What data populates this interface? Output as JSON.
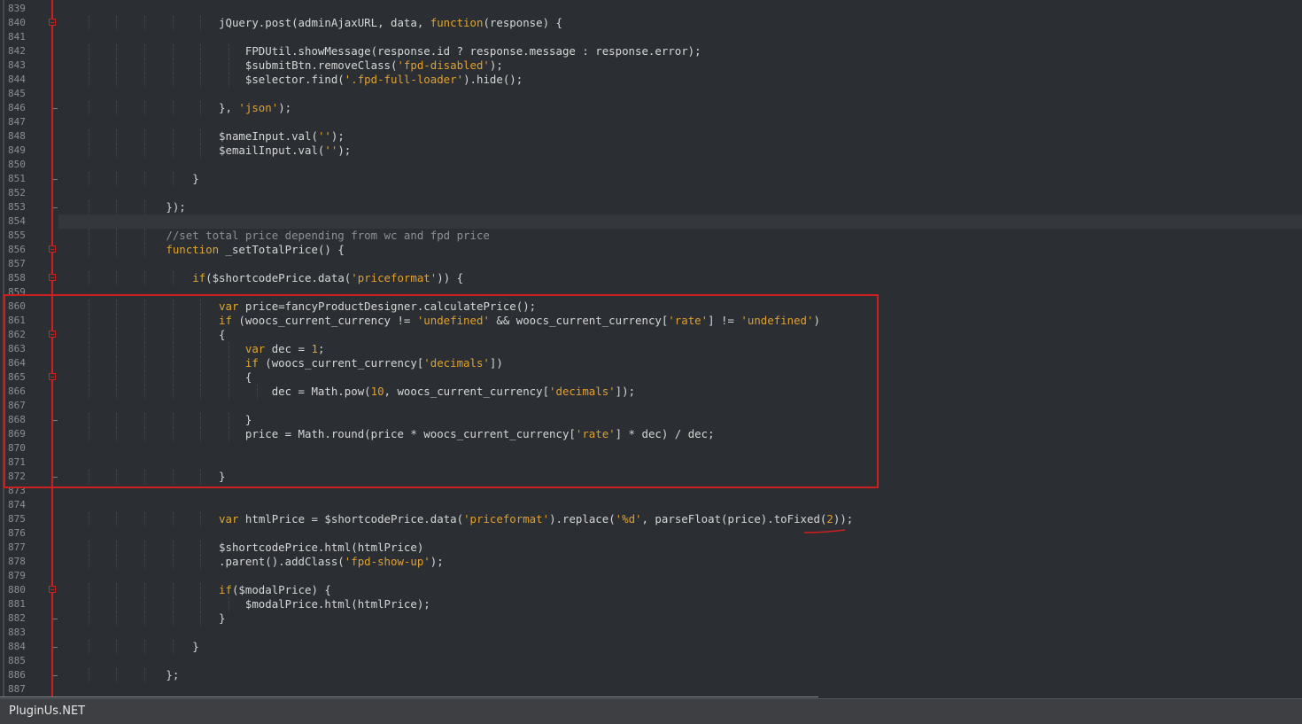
{
  "editor": {
    "current_line": "854",
    "lines": [
      {
        "n": "839",
        "fold": "",
        "tokens": []
      },
      {
        "n": "840",
        "fold": "open",
        "tokens": [
          [
            "t",
            "                        jQuery.post(adminAjaxURL, data, "
          ],
          [
            "kw",
            "function"
          ],
          [
            "t",
            "(response) {"
          ]
        ]
      },
      {
        "n": "841",
        "fold": "",
        "tokens": []
      },
      {
        "n": "842",
        "fold": "",
        "tokens": [
          [
            "t",
            "                            FPDUtil.showMessage(response.id ? response.message : response.error);"
          ]
        ]
      },
      {
        "n": "843",
        "fold": "",
        "tokens": [
          [
            "t",
            "                            $submitBtn.removeClass("
          ],
          [
            "str",
            "'fpd-disabled'"
          ],
          [
            "t",
            ");"
          ]
        ]
      },
      {
        "n": "844",
        "fold": "",
        "tokens": [
          [
            "t",
            "                            $selector.find("
          ],
          [
            "str",
            "'.fpd-full-loader'"
          ],
          [
            "t",
            ").hide();"
          ]
        ]
      },
      {
        "n": "845",
        "fold": "",
        "tokens": []
      },
      {
        "n": "846",
        "fold": "end",
        "tokens": [
          [
            "t",
            "                        }, "
          ],
          [
            "str",
            "'json'"
          ],
          [
            "t",
            ");"
          ]
        ]
      },
      {
        "n": "847",
        "fold": "",
        "tokens": []
      },
      {
        "n": "848",
        "fold": "",
        "tokens": [
          [
            "t",
            "                        $nameInput.val("
          ],
          [
            "str",
            "''"
          ],
          [
            "t",
            ");"
          ]
        ]
      },
      {
        "n": "849",
        "fold": "",
        "tokens": [
          [
            "t",
            "                        $emailInput.val("
          ],
          [
            "str",
            "''"
          ],
          [
            "t",
            ");"
          ]
        ]
      },
      {
        "n": "850",
        "fold": "",
        "tokens": []
      },
      {
        "n": "851",
        "fold": "end",
        "tokens": [
          [
            "t",
            "                    }"
          ]
        ]
      },
      {
        "n": "852",
        "fold": "",
        "tokens": []
      },
      {
        "n": "853",
        "fold": "end",
        "tokens": [
          [
            "t",
            "                });"
          ]
        ]
      },
      {
        "n": "854",
        "fold": "",
        "tokens": []
      },
      {
        "n": "855",
        "fold": "",
        "tokens": [
          [
            "cmt",
            "                //set total price depending from wc and fpd price"
          ]
        ]
      },
      {
        "n": "856",
        "fold": "open",
        "tokens": [
          [
            "kw",
            "                function"
          ],
          [
            "t",
            " _setTotalPrice() {"
          ]
        ]
      },
      {
        "n": "857",
        "fold": "",
        "tokens": []
      },
      {
        "n": "858",
        "fold": "open",
        "tokens": [
          [
            "t",
            "                    "
          ],
          [
            "kw",
            "if"
          ],
          [
            "t",
            "($shortcodePrice.data("
          ],
          [
            "str",
            "'priceformat'"
          ],
          [
            "t",
            ")) {"
          ]
        ]
      },
      {
        "n": "859",
        "fold": "",
        "tokens": []
      },
      {
        "n": "860",
        "fold": "",
        "tokens": [
          [
            "t",
            "                        "
          ],
          [
            "kw",
            "var"
          ],
          [
            "t",
            " price=fancyProductDesigner.calculatePrice();"
          ]
        ]
      },
      {
        "n": "861",
        "fold": "",
        "tokens": [
          [
            "t",
            "                        "
          ],
          [
            "kw",
            "if"
          ],
          [
            "t",
            " (woocs_current_currency != "
          ],
          [
            "str",
            "'undefined'"
          ],
          [
            "t",
            " && woocs_current_currency["
          ],
          [
            "str",
            "'rate'"
          ],
          [
            "t",
            "] != "
          ],
          [
            "str",
            "'undefined'"
          ],
          [
            "t",
            ")"
          ]
        ]
      },
      {
        "n": "862",
        "fold": "open",
        "tokens": [
          [
            "t",
            "                        {"
          ]
        ]
      },
      {
        "n": "863",
        "fold": "",
        "tokens": [
          [
            "t",
            "                            "
          ],
          [
            "kw",
            "var"
          ],
          [
            "t",
            " dec = "
          ],
          [
            "num",
            "1"
          ],
          [
            "t",
            ";"
          ]
        ]
      },
      {
        "n": "864",
        "fold": "",
        "tokens": [
          [
            "t",
            "                            "
          ],
          [
            "kw",
            "if"
          ],
          [
            "t",
            " (woocs_current_currency["
          ],
          [
            "str",
            "'decimals'"
          ],
          [
            "t",
            "])"
          ]
        ]
      },
      {
        "n": "865",
        "fold": "open",
        "tokens": [
          [
            "t",
            "                            {"
          ]
        ]
      },
      {
        "n": "866",
        "fold": "",
        "tokens": [
          [
            "t",
            "                                dec = Math.pow("
          ],
          [
            "num",
            "10"
          ],
          [
            "t",
            ", woocs_current_currency["
          ],
          [
            "str",
            "'decimals'"
          ],
          [
            "t",
            "]);"
          ]
        ]
      },
      {
        "n": "867",
        "fold": "",
        "tokens": []
      },
      {
        "n": "868",
        "fold": "end",
        "tokens": [
          [
            "t",
            "                            }"
          ]
        ]
      },
      {
        "n": "869",
        "fold": "",
        "tokens": [
          [
            "t",
            "                            price = Math.round(price * woocs_current_currency["
          ],
          [
            "str",
            "'rate'"
          ],
          [
            "t",
            "] * dec) / dec;"
          ]
        ]
      },
      {
        "n": "870",
        "fold": "",
        "tokens": []
      },
      {
        "n": "871",
        "fold": "",
        "tokens": []
      },
      {
        "n": "872",
        "fold": "end",
        "tokens": [
          [
            "t",
            "                        }"
          ]
        ]
      },
      {
        "n": "873",
        "fold": "",
        "tokens": []
      },
      {
        "n": "874",
        "fold": "",
        "tokens": []
      },
      {
        "n": "875",
        "fold": "",
        "tokens": [
          [
            "t",
            "                        "
          ],
          [
            "kw",
            "var"
          ],
          [
            "t",
            " htmlPrice = $shortcodePrice.data("
          ],
          [
            "str",
            "'priceformat'"
          ],
          [
            "t",
            ").replace("
          ],
          [
            "str",
            "'%d'"
          ],
          [
            "t",
            ", parseFloat(price).toFixed("
          ],
          [
            "num",
            "2"
          ],
          [
            "t",
            "));"
          ]
        ]
      },
      {
        "n": "876",
        "fold": "",
        "tokens": []
      },
      {
        "n": "877",
        "fold": "",
        "tokens": [
          [
            "t",
            "                        $shortcodePrice.html(htmlPrice)"
          ]
        ]
      },
      {
        "n": "878",
        "fold": "",
        "tokens": [
          [
            "t",
            "                        .parent().addClass("
          ],
          [
            "str",
            "'fpd-show-up'"
          ],
          [
            "t",
            ");"
          ]
        ]
      },
      {
        "n": "879",
        "fold": "",
        "tokens": []
      },
      {
        "n": "880",
        "fold": "open",
        "tokens": [
          [
            "t",
            "                        "
          ],
          [
            "kw",
            "if"
          ],
          [
            "t",
            "($modalPrice) {"
          ]
        ]
      },
      {
        "n": "881",
        "fold": "",
        "tokens": [
          [
            "t",
            "                            $modalPrice.html(htmlPrice);"
          ]
        ]
      },
      {
        "n": "882",
        "fold": "end",
        "tokens": [
          [
            "t",
            "                        }"
          ]
        ]
      },
      {
        "n": "883",
        "fold": "",
        "tokens": []
      },
      {
        "n": "884",
        "fold": "end",
        "tokens": [
          [
            "t",
            "                    }"
          ]
        ]
      },
      {
        "n": "885",
        "fold": "",
        "tokens": []
      },
      {
        "n": "886",
        "fold": "end",
        "tokens": [
          [
            "t",
            "                };"
          ]
        ]
      },
      {
        "n": "887",
        "fold": "",
        "tokens": []
      }
    ]
  },
  "statusbar": {
    "text": "PluginUs.NET"
  },
  "colors": {
    "background": "#2b2f33",
    "keyword": "#e0a52f",
    "string": "#e09f30",
    "comment": "#8b9096",
    "annotation": "#cc1f1f"
  }
}
